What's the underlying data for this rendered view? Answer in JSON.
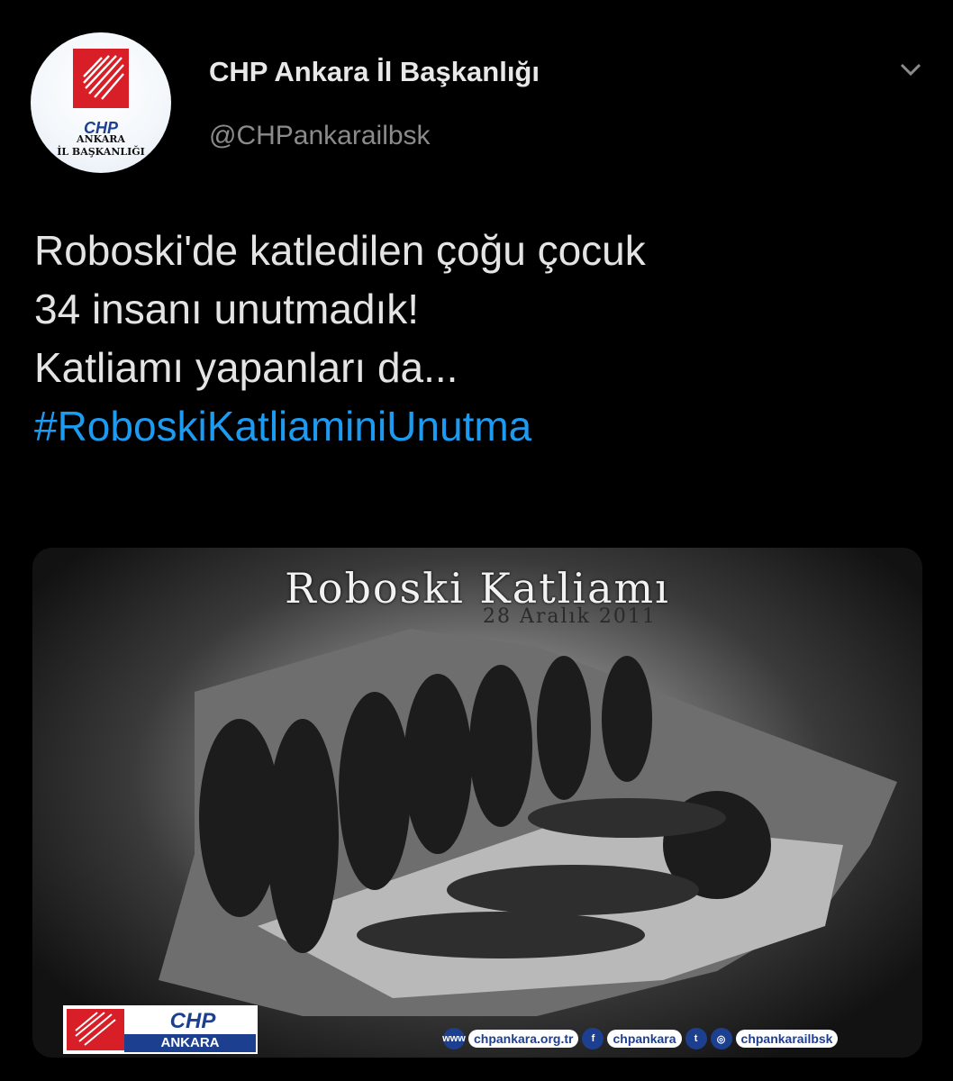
{
  "profile": {
    "avatar_text_main": "CHP",
    "avatar_text_line1": "ANKARA",
    "avatar_text_line2": "İL BAŞKANLIĞI",
    "display_name": "CHP Ankara İl Başkanlığı",
    "handle": "@CHPankarailbsk"
  },
  "tweet": {
    "lines": [
      "Roboski'de katledilen çoğu çocuk",
      "34 insanı unutmadık!",
      "Katliamı yapanları da..."
    ],
    "hashtag": "#RoboskiKatliaminiUnutma"
  },
  "media": {
    "title": "Roboski Katliamı",
    "date": "28 Aralık 2011",
    "logo_main": "CHP",
    "logo_sub": "ANKARA",
    "website": "chpankara.org.tr",
    "facebook": "chpankara",
    "instagram": "chpankarailbsk",
    "www_label": "www"
  },
  "colors": {
    "hashtag": "#1d9bf0",
    "chp_red": "#d81e26",
    "chp_blue": "#1d3f8f"
  },
  "icons": [
    "chevron-down-icon",
    "globe-icon",
    "facebook-icon",
    "twitter-icon",
    "instagram-icon"
  ]
}
